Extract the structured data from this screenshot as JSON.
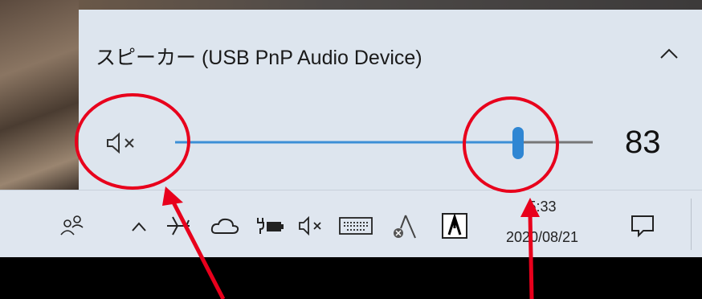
{
  "volume_flyout": {
    "device_label": "スピーカー (USB PnP Audio Device)",
    "mute_icon": "speaker-muted-icon",
    "collapse_icon": "chevron-up-icon",
    "volume_value": "83",
    "volume_level": 83
  },
  "taskbar": {
    "people_icon": "people-icon",
    "show_hidden_icon": "chevron-up-icon",
    "tray_icons": [
      "airplane-icon",
      "onedrive-cloud-icon",
      "battery-charging-icon",
      "speaker-muted-icon",
      "keyboard-icon",
      "app-icon",
      "app-icon"
    ],
    "clock_time": "5:33",
    "clock_date": "2020/08/21",
    "notification_icon": "action-center-icon"
  },
  "annotation_colors": {
    "circle": "#e8001c",
    "arrow": "#e8001c"
  }
}
